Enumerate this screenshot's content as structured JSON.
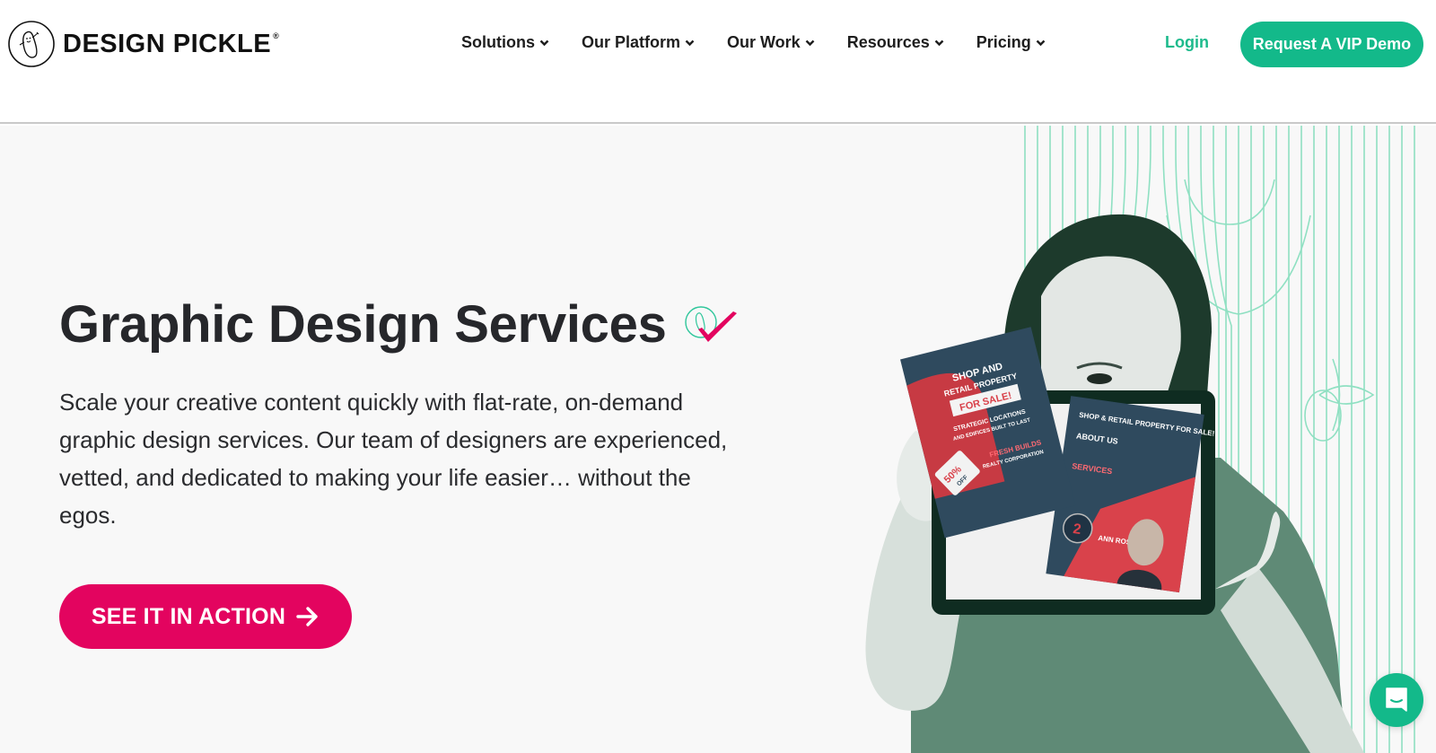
{
  "brand": {
    "name": "DESIGN PICKLE",
    "registered_mark": "®",
    "colors": {
      "green": "#13b98a",
      "pink": "#e3045f",
      "dark": "#26272b"
    }
  },
  "nav": {
    "items": [
      {
        "label": "Solutions",
        "icon": "chevron-down-icon"
      },
      {
        "label": "Our Platform",
        "icon": "chevron-down-icon"
      },
      {
        "label": "Our Work",
        "icon": "chevron-down-icon"
      },
      {
        "label": "Resources",
        "icon": "chevron-down-icon"
      },
      {
        "label": "Pricing",
        "icon": "chevron-down-icon"
      }
    ],
    "login_label": "Login",
    "demo_label": "Request A VIP Demo"
  },
  "hero": {
    "title": "Graphic Design Services",
    "subtitle": "Scale your creative content quickly with flat-rate, on-demand graphic design services. Our team of designers are experienced, vetted, and dedicated to making your life easier… without the egos.",
    "cta_label": "SEE IT IN ACTION",
    "cta_icon": "arrow-right-icon",
    "image": {
      "description": "woman holding tablet displaying flyers",
      "flyer_left": {
        "headline_1": "SHOP AND",
        "headline_2": "RETAIL PROPERTY",
        "headline_3": "FOR SALE!",
        "tagline_1": "STRATEGIC LOCATIONS",
        "tagline_2": "AND EDIFICES BUILT TO LAST",
        "tag": "50%",
        "tag_sub": "OFF",
        "company_1": "FRESH BUILDS",
        "company_2": "REALTY CORPORATION"
      },
      "flyer_right": {
        "headline": "SHOP & RETAIL PROPERTY FOR SALE!",
        "section_1": "ABOUT US",
        "section_2": "SERVICES",
        "badge_num": "2",
        "agent": "ANN ROSE"
      }
    }
  },
  "chat": {
    "icon": "chat-icon"
  }
}
